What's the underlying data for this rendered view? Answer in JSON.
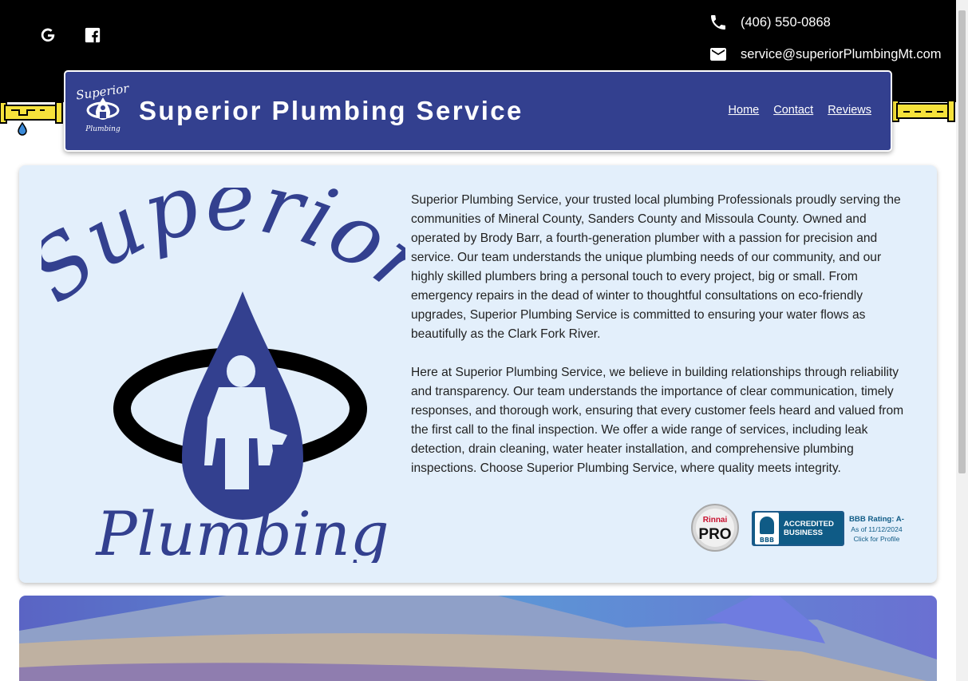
{
  "topbar": {
    "phone": "(406) 550-0868",
    "email": "service@superiorPlumbingMt.com",
    "icons": [
      "google-icon",
      "facebook-icon",
      "phone-icon",
      "mail-icon"
    ]
  },
  "header": {
    "logo_top": "Superior",
    "logo_bottom": "Plumbing",
    "title": "Superior Plumbing Service",
    "nav": [
      "Home",
      "Contact",
      "Reviews"
    ]
  },
  "main": {
    "logo_word_top": "Superior",
    "logo_word_bottom": "Plumbing",
    "paragraphs": [
      "Superior Plumbing Service, your trusted local plumbing Professionals proudly serving the communities of Mineral County, Sanders County and Missoula County. Owned and operated by Brody Barr, a fourth-generation plumber with a passion for precision and service. Our team understands the unique plumbing needs of our community, and our highly skilled plumbers bring a personal touch to every project, big or small. From emergency repairs in the dead of winter to thoughtful consultations on eco-friendly upgrades, Superior Plumbing Service is committed to ensuring your water flows as beautifully as the Clark Fork River.",
      "Here at Superior Plumbing Service, we believe in building relationships through reliability and transparency. Our team understands the importance of clear communication, timely responses, and thorough work, ensuring that every customer feels heard and valued from the first call to the final inspection. We offer a wide range of services, including leak detection, drain cleaning, water heater installation, and comprehensive plumbing inspections. Choose Superior Plumbing Service, where quality meets integrity."
    ],
    "rinnai": {
      "brand": "Rinnai",
      "label": "PRO"
    },
    "bbb": {
      "logo_text": "BBB",
      "seal_line1": "ACCREDITED",
      "seal_line2": "BUSINESS",
      "rating": "BBB Rating: A-",
      "as_of": "As of 11/12/2024",
      "link": "Click for Profile"
    }
  },
  "colors": {
    "brand_blue": "#33408f",
    "card_bg": "#e3effb",
    "pipe_yellow": "#f6e23b",
    "topbar": "#000000"
  }
}
